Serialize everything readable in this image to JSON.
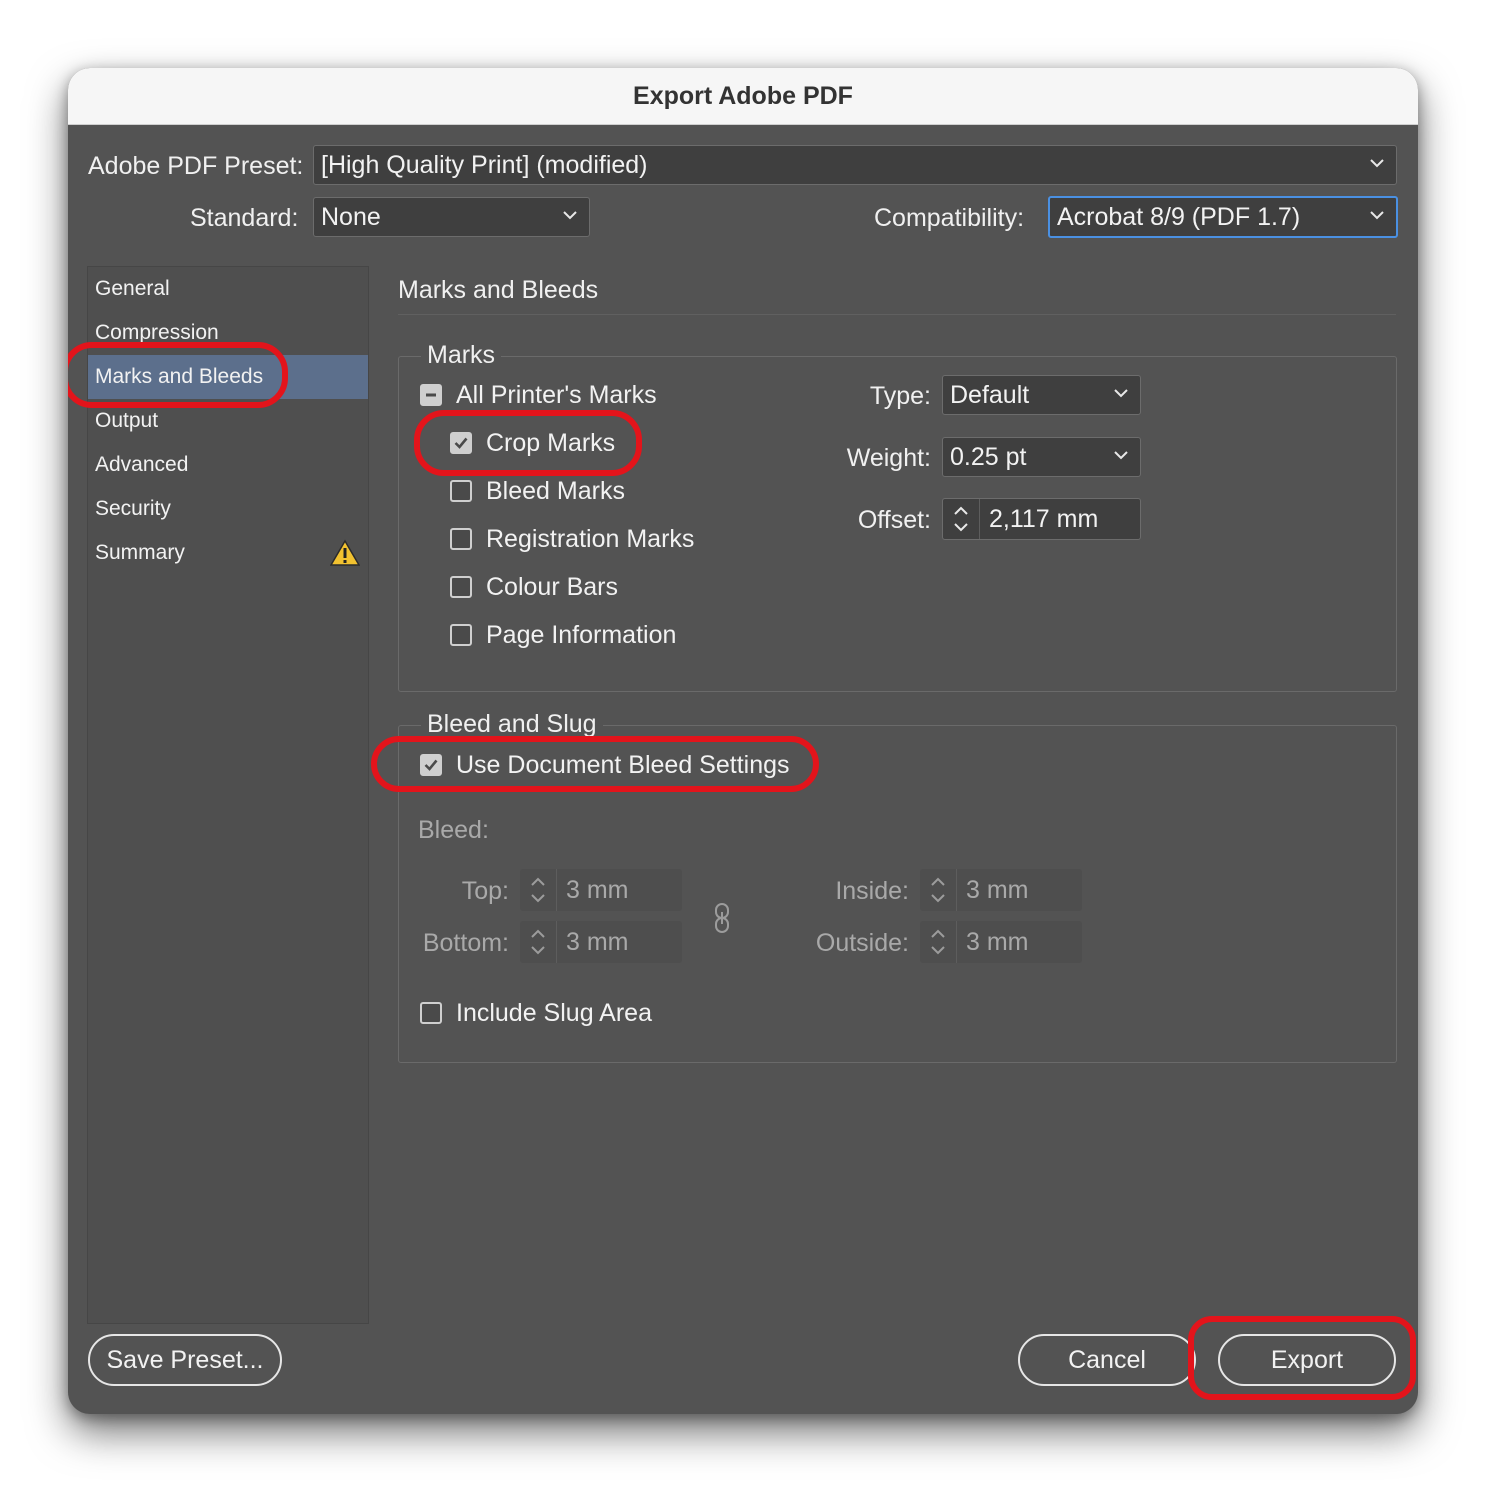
{
  "window": {
    "title": "Export Adobe PDF"
  },
  "preset": {
    "label": "Adobe PDF Preset:",
    "value": "[High Quality Print] (modified)"
  },
  "standard": {
    "label": "Standard:",
    "value": "None"
  },
  "compatibility": {
    "label": "Compatibility:",
    "value": "Acrobat 8/9 (PDF 1.7)"
  },
  "sidebar": {
    "items": [
      {
        "label": "General"
      },
      {
        "label": "Compression"
      },
      {
        "label": "Marks and Bleeds",
        "selected": true
      },
      {
        "label": "Output"
      },
      {
        "label": "Advanced"
      },
      {
        "label": "Security"
      },
      {
        "label": "Summary",
        "icon": "warning-icon"
      }
    ]
  },
  "panel": {
    "title": "Marks and Bleeds"
  },
  "marks": {
    "legend": "Marks",
    "all_printers_marks": {
      "label": "All Printer's Marks",
      "state": "mixed"
    },
    "crop_marks": {
      "label": "Crop Marks",
      "checked": true
    },
    "bleed_marks": {
      "label": "Bleed Marks",
      "checked": false
    },
    "registration_marks": {
      "label": "Registration Marks",
      "checked": false
    },
    "colour_bars": {
      "label": "Colour Bars",
      "checked": false
    },
    "page_information": {
      "label": "Page Information",
      "checked": false
    },
    "type": {
      "label": "Type:",
      "value": "Default"
    },
    "weight": {
      "label": "Weight:",
      "value": "0.25 pt"
    },
    "offset": {
      "label": "Offset:",
      "value": "2,117 mm"
    }
  },
  "bleed_slug": {
    "legend": "Bleed and Slug",
    "use_document_bleed": {
      "label": "Use Document Bleed Settings",
      "checked": true
    },
    "bleed_label": "Bleed:",
    "top": {
      "label": "Top:",
      "value": "3 mm"
    },
    "bottom": {
      "label": "Bottom:",
      "value": "3 mm"
    },
    "inside": {
      "label": "Inside:",
      "value": "3 mm"
    },
    "outside": {
      "label": "Outside:",
      "value": "3 mm"
    },
    "include_slug": {
      "label": "Include Slug Area",
      "checked": false
    }
  },
  "buttons": {
    "save_preset": "Save Preset...",
    "cancel": "Cancel",
    "export": "Export"
  },
  "colors": {
    "dialog_bg": "#535353",
    "selection": "#5c6f8c",
    "highlight": "#e3141b",
    "focus": "#4a90e2"
  }
}
